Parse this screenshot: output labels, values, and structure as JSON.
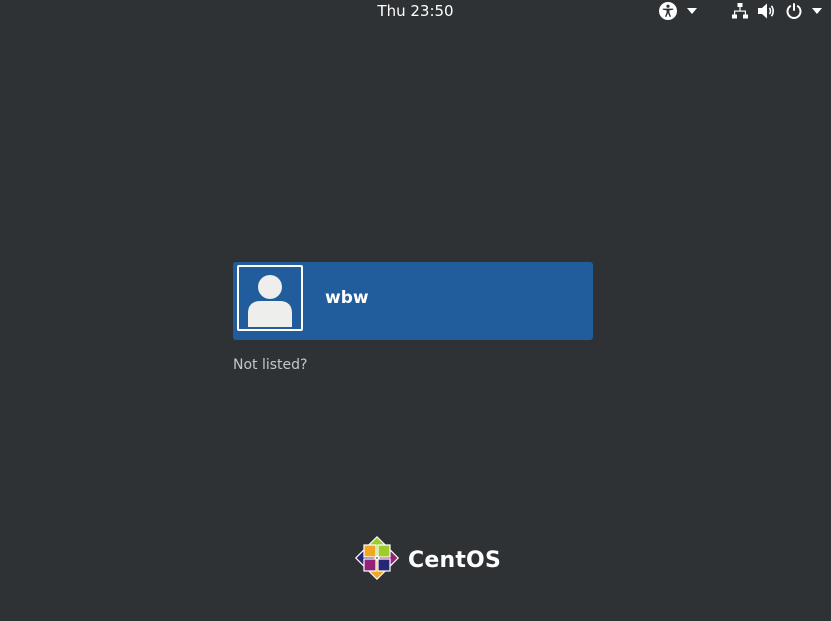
{
  "topbar": {
    "clock": "Thu 23:50",
    "icons": [
      "accessibility-icon",
      "dropdown-arrow-icon",
      "network-icon",
      "volume-icon",
      "power-icon",
      "dropdown-arrow-icon"
    ]
  },
  "login": {
    "user": {
      "name": "wbw",
      "avatar": "user-avatar-icon"
    },
    "not_listed": "Not listed?"
  },
  "branding": {
    "logo_text": "CentOS",
    "logo_icon": "centos-logo-icon"
  },
  "colors": {
    "background": "#2f3234",
    "selected_user": "#215d9c",
    "text": "#ffffff",
    "muted_text": "#c4c6c8"
  }
}
